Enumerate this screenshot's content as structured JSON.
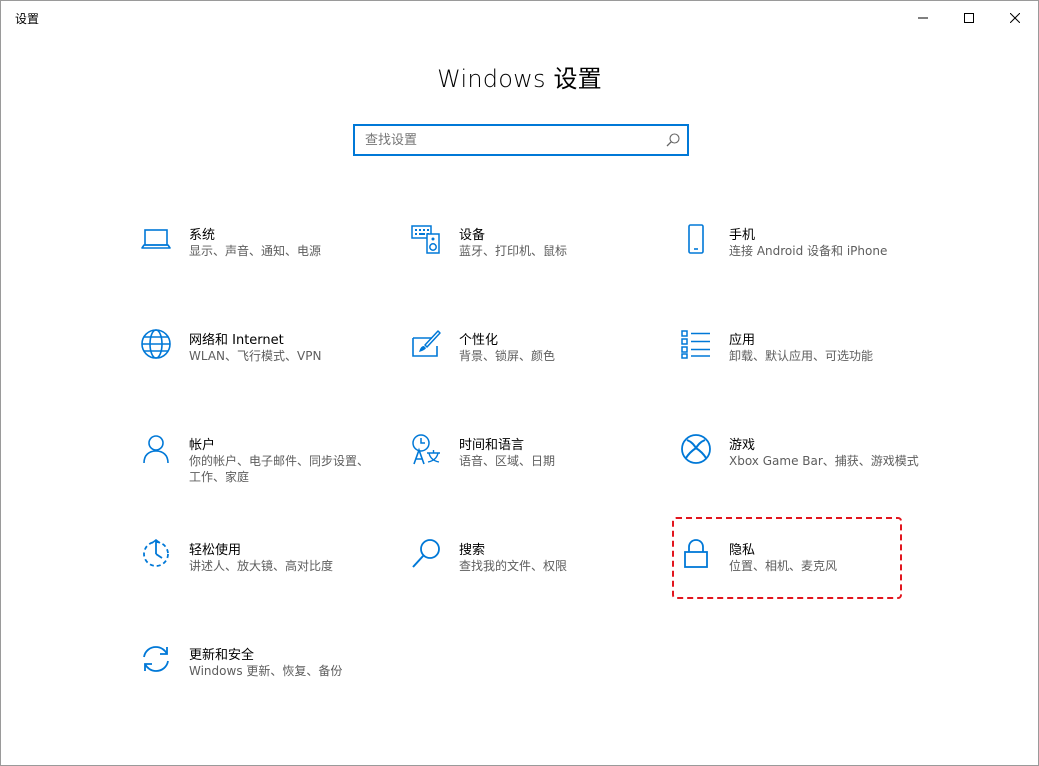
{
  "window": {
    "title": "设置",
    "controls": {
      "minimize": "minimize-icon",
      "maximize": "maximize-icon",
      "close": "close-icon"
    }
  },
  "heading": "Windows 设置",
  "search": {
    "placeholder": "查找设置",
    "value": "",
    "icon": "search-icon"
  },
  "accent_color": "#0078d7",
  "highlight_color": "#e2161e",
  "tiles": [
    {
      "id": "system",
      "title": "系统",
      "desc": "显示、声音、通知、电源",
      "icon": "laptop-icon"
    },
    {
      "id": "devices",
      "title": "设备",
      "desc": "蓝牙、打印机、鼠标",
      "icon": "keyboard-speaker-icon"
    },
    {
      "id": "phone",
      "title": "手机",
      "desc": "连接 Android 设备和 iPhone",
      "icon": "phone-icon"
    },
    {
      "id": "network",
      "title": "网络和 Internet",
      "desc": "WLAN、飞行模式、VPN",
      "icon": "globe-icon"
    },
    {
      "id": "personalization",
      "title": "个性化",
      "desc": "背景、锁屏、颜色",
      "icon": "paint-brush-icon"
    },
    {
      "id": "apps",
      "title": "应用",
      "desc": "卸载、默认应用、可选功能",
      "icon": "app-list-icon"
    },
    {
      "id": "accounts",
      "title": "帐户",
      "desc": "你的帐户、电子邮件、同步设置、工作、家庭",
      "icon": "person-icon"
    },
    {
      "id": "time-language",
      "title": "时间和语言",
      "desc": "语音、区域、日期",
      "icon": "time-language-icon"
    },
    {
      "id": "gaming",
      "title": "游戏",
      "desc": "Xbox Game Bar、捕获、游戏模式",
      "icon": "xbox-icon"
    },
    {
      "id": "ease-of-access",
      "title": "轻松使用",
      "desc": "讲述人、放大镜、高对比度",
      "icon": "ease-of-access-icon"
    },
    {
      "id": "search",
      "title": "搜索",
      "desc": "查找我的文件、权限",
      "icon": "search-magnifier-icon"
    },
    {
      "id": "privacy",
      "title": "隐私",
      "desc": "位置、相机、麦克风",
      "icon": "lock-icon"
    },
    {
      "id": "update-security",
      "title": "更新和安全",
      "desc": "Windows 更新、恢复、备份",
      "icon": "sync-icon"
    }
  ]
}
